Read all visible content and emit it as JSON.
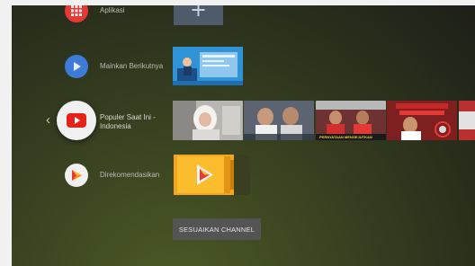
{
  "rows": [
    {
      "label": "Aplikasi",
      "icon": "apps-grid-icon",
      "color": "#e53935"
    },
    {
      "label": "Mainkan Berikutnya",
      "icon": "play-icon",
      "color": "#3d7bd8"
    },
    {
      "label": "Populer Saat Ini - Indonesia",
      "icon": "youtube-icon",
      "color": "#f0f0f0"
    },
    {
      "label": "Direkomendasikan",
      "icon": "google-play-movies-icon",
      "color": "#f0f0f0"
    }
  ],
  "tiles": {
    "add_app": {
      "icon": "plus-icon"
    },
    "thumbnail_overlay_texts": [
      "PERNYATAAN MENGEJUTKAN"
    ]
  },
  "customize_button": {
    "label": "SESUAIKAN CHANNEL"
  }
}
